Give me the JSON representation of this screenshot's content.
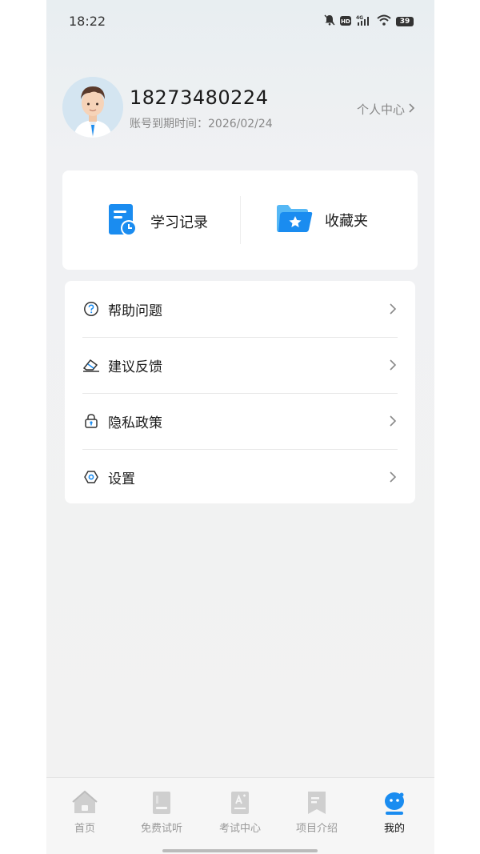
{
  "status_bar": {
    "time": "18:22",
    "battery": "39",
    "network": "4G"
  },
  "profile": {
    "phone": "18273480224",
    "expire_label": "账号到期时间：",
    "expire_date": "2026/02/24",
    "personal_center": "个人中心"
  },
  "quick": [
    {
      "label": "学习记录",
      "icon": "study-record-icon"
    },
    {
      "label": "收藏夹",
      "icon": "favorites-folder-icon"
    }
  ],
  "menu": [
    {
      "label": "帮助问题",
      "icon": "help-question-icon"
    },
    {
      "label": "建议反馈",
      "icon": "feedback-eraser-icon"
    },
    {
      "label": "隐私政策",
      "icon": "privacy-lock-icon"
    },
    {
      "label": "设置",
      "icon": "settings-hexagon-icon"
    }
  ],
  "tabs": [
    {
      "label": "首页",
      "icon": "home-icon",
      "active": false
    },
    {
      "label": "免费试听",
      "icon": "book-icon",
      "active": false
    },
    {
      "label": "考试中心",
      "icon": "exam-icon",
      "active": false
    },
    {
      "label": "项目介绍",
      "icon": "bookmark-icon",
      "active": false
    },
    {
      "label": "我的",
      "icon": "my-robot-icon",
      "active": true
    }
  ],
  "colors": {
    "accent": "#1a8cf0",
    "inactive_tab": "#c9c9c9",
    "text_primary": "#1a1a1a",
    "text_secondary": "#888888"
  }
}
